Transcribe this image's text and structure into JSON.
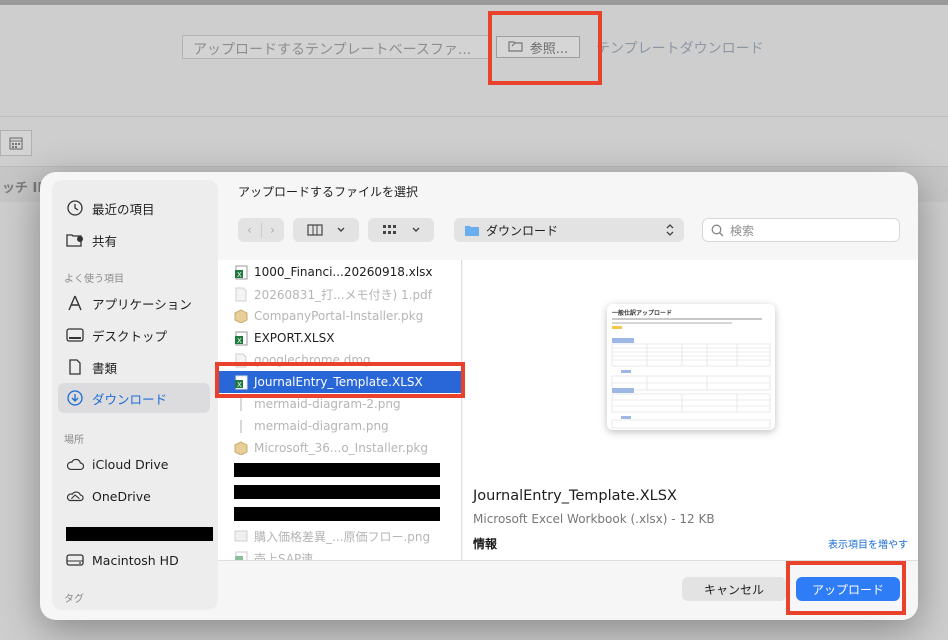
{
  "background": {
    "upload_placeholder": "アップロードするテンプレートベースファ...",
    "browse_label": "参照...",
    "template_download_label": "テンプレートダウンロード",
    "column_label": "ッチ ID"
  },
  "dialog": {
    "title": "アップロードするファイルを選択",
    "toolbar": {
      "location": "ダウンロード",
      "search_placeholder": "検索"
    },
    "sidebar": {
      "items_top": [
        {
          "label": "最近の項目",
          "icon": "clock-icon"
        },
        {
          "label": "共有",
          "icon": "shared-folder-icon"
        }
      ],
      "favorites_header": "よく使う項目",
      "favorites": [
        {
          "label": "アプリケーション",
          "icon": "applications-icon"
        },
        {
          "label": "デスクトップ",
          "icon": "desktop-icon"
        },
        {
          "label": "書類",
          "icon": "document-icon"
        },
        {
          "label": "ダウンロード",
          "icon": "download-icon",
          "active": true
        }
      ],
      "locations_header": "場所",
      "locations": [
        {
          "label": "iCloud Drive",
          "icon": "cloud-icon"
        },
        {
          "label": "OneDrive",
          "icon": "onedrive-icon"
        },
        {
          "label": "Macintosh HD",
          "icon": "disk-icon"
        }
      ],
      "tags_header": "タグ"
    },
    "files": [
      {
        "name": "1000_Financi...20260918.xlsx",
        "type": "xlsx",
        "enabled": true
      },
      {
        "name": "20260831_打...メモ付き) 1.pdf",
        "type": "pdf",
        "enabled": false
      },
      {
        "name": "CompanyPortal-Installer.pkg",
        "type": "pkg",
        "enabled": false
      },
      {
        "name": "EXPORT.XLSX",
        "type": "xlsx",
        "enabled": true
      },
      {
        "name": "googlechrome.dmg",
        "type": "dmg",
        "enabled": false
      },
      {
        "name": "JournalEntry_Template.XLSX",
        "type": "xlsx",
        "enabled": true,
        "selected": true
      },
      {
        "name": "mermaid-diagram-2.png",
        "type": "png",
        "enabled": false
      },
      {
        "name": "mermaid-diagram.png",
        "type": "png",
        "enabled": false
      },
      {
        "name": "Microsoft_36...o_Installer.pkg",
        "type": "pkg",
        "enabled": false
      },
      {
        "name": "購入価格差異_...原価フロー.png",
        "type": "png",
        "enabled": false
      },
      {
        "name": "売上SAP連...",
        "type": "xlsx",
        "enabled": false
      }
    ],
    "preview": {
      "name": "JournalEntry_Template.XLSX",
      "kind": "Microsoft Excel Workbook (.xlsx) - 12 KB",
      "info_label": "情報",
      "more_label": "表示項目を増やす",
      "thumb_title": "一般仕訳アップロード"
    },
    "buttons": {
      "cancel": "キャンセル",
      "upload": "アップロード"
    }
  },
  "colors": {
    "accent": "#2f7df6",
    "selection": "#2966d8",
    "highlight": "#e8422d"
  }
}
